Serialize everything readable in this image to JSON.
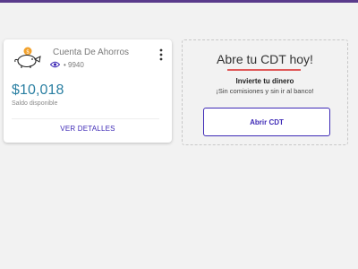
{
  "account_card": {
    "account_name": "Cuenta De Ahorros",
    "account_number_masked": "• 9940",
    "balance": "$10,018",
    "balance_label": "Saldo disponible",
    "details_link": "VER DETALLES",
    "icons": {
      "piggy_bank": "piggy-bank-icon",
      "visibility": "eye-icon",
      "menu": "kebab-menu-icon"
    }
  },
  "promo_card": {
    "title": "Abre tu CDT hoy!",
    "subtitle": "Invierte tu dinero",
    "description": "¡Sin comisiones y sin ir al banco!",
    "button_label": "Abrir CDT"
  },
  "colors": {
    "accent": "#3e2ab6",
    "balance": "#2a7fa2",
    "underline": "#e05a5a",
    "topbar": "#5a3b8c"
  }
}
